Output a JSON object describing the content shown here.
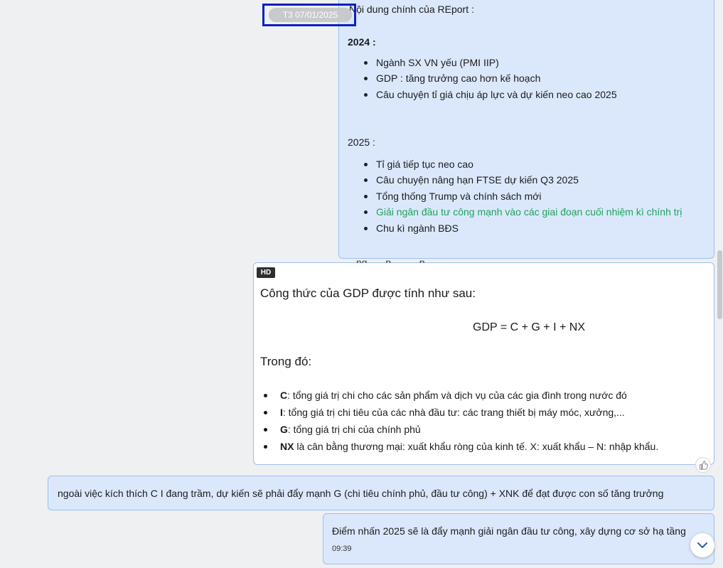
{
  "date_pill": "T3 07/01/2025",
  "msg1": {
    "intro": "Nội dung chính của REport :",
    "heading_2024": "2024 :",
    "items_2024": [
      "Ngành SX VN yếu (PMI IIP)",
      "GDP : tăng trưởng  cao hơn kế  hoạch",
      "Câu chuyện tỉ giá chịu áp lực và dự kiến neo cao 2025"
    ],
    "heading_2025": "2025 :",
    "items_2025": [
      "Tỉ giá tiếp tục neo cao",
      "Câu chuyện nâng hạn FTSE dự kiến Q3 2025",
      "Tổng thống Trump và chính sách mới",
      "Giải ngân đầu tư công mạnh vào các giai đoạn cuối nhiệm kì chính trị",
      "Chu kì ngành BĐS"
    ],
    "highlight_color": "#1ea35b"
  },
  "msg2": {
    "clipped_text": "…ng, …       p    …      …   p      …    …",
    "hd_badge": "HD",
    "formula_intro": "Công thức của GDP được tính như sau:",
    "formula": "GDP = C + G + I + NX",
    "where": "Trong đó:",
    "items": [
      {
        "term": "C",
        "desc": ": tổng giá trị chi cho các sản phẩm và dịch vụ của các gia đình trong nước đó"
      },
      {
        "term": "I",
        "desc": ": tổng giá trị chi tiêu của các nhà đầu tư: các trang thiết bị máy móc, xưởng,..."
      },
      {
        "term": "G",
        "desc": ": tổng giá trị chi của chính phủ"
      },
      {
        "term": "NX",
        "desc": " là cân bằng thương mại: xuất khẩu ròng của kinh tế. X: xuất khẩu – N: nhập khẩu."
      }
    ]
  },
  "msg3": {
    "text": "ngoài việc kích thích C I đang trầm, dự kiến sẽ phải đẩy mạnh G (chi tiêu chính phủ, đầu tư công) + XNK để đạt được con số tăng trưởng"
  },
  "msg4": {
    "text": "Điểm nhấn 2025 sẽ là đẩy mạnh giải ngân đầu tư công, xây dựng cơ sở hạ tầng",
    "time": "09:39"
  },
  "icons": {
    "like": "thumbs-up-icon",
    "scroll": "chevron-down-icon"
  },
  "colors": {
    "bubble_bg": "#dbe8fc",
    "bubble_border": "#9fbff0",
    "date_highlight": "#0c1fbf"
  }
}
